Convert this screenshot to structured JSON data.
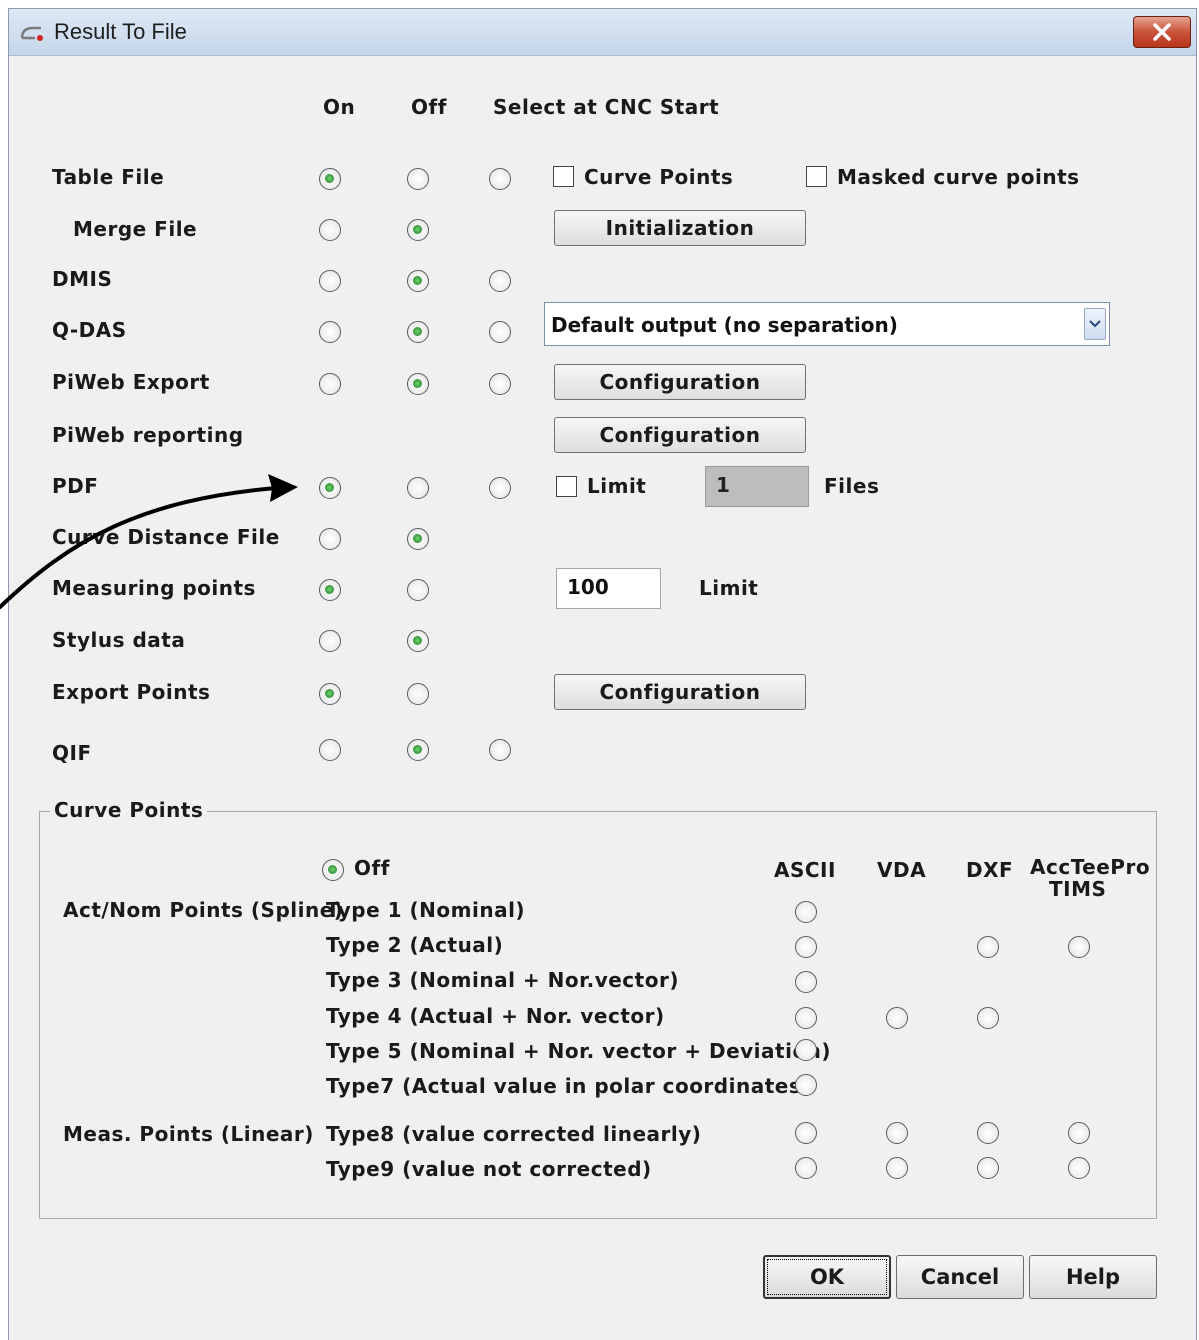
{
  "window": {
    "title": "Result To File"
  },
  "columns": {
    "on": "On",
    "off": "Off",
    "select": "Select at CNC Start"
  },
  "rows": {
    "table_file": "Table File",
    "merge_file": "Merge File",
    "dmis": "DMIS",
    "qdas": "Q-DAS",
    "piweb_export": "PiWeb Export",
    "piweb_reporting": "PiWeb reporting",
    "pdf": "PDF",
    "curve_distance_file": "Curve Distance File",
    "measuring_points": "Measuring points",
    "stylus_data": "Stylus data",
    "export_points": "Export Points",
    "qif": "QIF"
  },
  "options": {
    "curve_points_label": "Curve Points",
    "masked_curve_points_label": "Masked curve points",
    "initialization_button": "Initialization",
    "configuration_button": "Configuration",
    "qdas_dropdown_value": "Default output (no separation)",
    "pdf_limit_label": "Limit",
    "pdf_limit_value": "1",
    "pdf_files_label": "Files",
    "measuring_limit_value": "100",
    "measuring_limit_label": "Limit"
  },
  "curve_points_group": {
    "title": "Curve Points",
    "off_label": "Off",
    "col_ascii": "ASCII",
    "col_vda": "VDA",
    "col_dxf": "DXF",
    "col_acctee_1": "AccTeePro",
    "col_acctee_2": "TIMS",
    "actnom_label": "Act/Nom Points (Spline)",
    "meas_label": "Meas. Points (Linear)",
    "type1": "Type 1 (Nominal)",
    "type2": "Type 2 (Actual)",
    "type3": "Type 3 (Nominal + Nor.vector)",
    "type4": "Type 4 (Actual + Nor. vector)",
    "type5": "Type 5 (Nominal + Nor. vector + Deviation)",
    "type7": "Type7 (Actual value in polar coordinates)",
    "type8": "Type8 (value corrected linearly)",
    "type9": "Type9 (value not corrected)"
  },
  "buttons": {
    "ok": "OK",
    "cancel": "Cancel",
    "help": "Help"
  },
  "colors": {
    "title_bar": "#c9d9ec",
    "close_button": "#c8543a",
    "radio_selected": "#1c7a24"
  }
}
